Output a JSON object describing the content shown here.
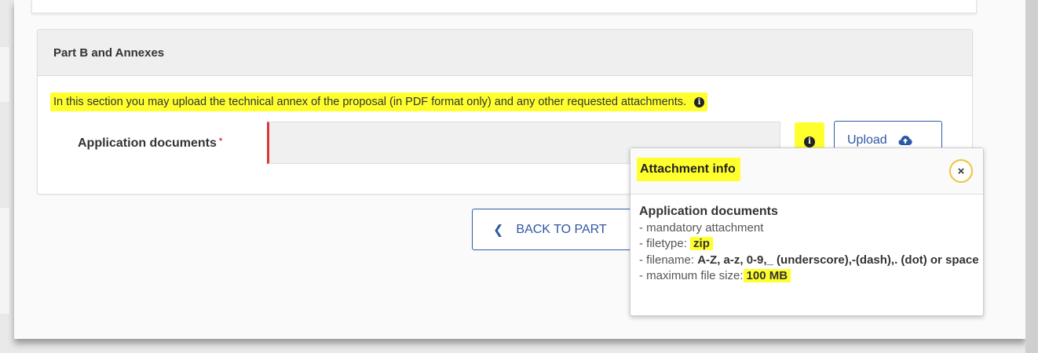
{
  "section": {
    "title": "Part B and Annexes",
    "info_text": "In this section you may upload the technical annex of the proposal (in PDF format only) and any other requested attachments.",
    "info_icon": "info-circle-icon"
  },
  "field": {
    "label": "Application documents",
    "required_marker": "*"
  },
  "buttons": {
    "upload_label": "Upload",
    "upload_icon": "cloud-upload-icon",
    "back_label": "BACK TO PART",
    "back_icon": "chevron-left-icon"
  },
  "popover": {
    "title": "Attachment info",
    "close_symbol": "×",
    "doc_title": "Application documents",
    "line1": "- mandatory attachment",
    "filetype_label": "- filetype:",
    "filetype_value": "zip",
    "filename_label": "- filename:",
    "filename_value": "A-Z, a-z, 0-9,_ (underscore),-(dash),. (dot) or space",
    "maxsize_label": "- maximum file size:",
    "maxsize_value": "100 MB"
  },
  "colors": {
    "highlight": "#ffff2e",
    "accent_blue": "#2d57a4",
    "required_red": "#d9383a",
    "close_ring": "#f0c23b"
  }
}
